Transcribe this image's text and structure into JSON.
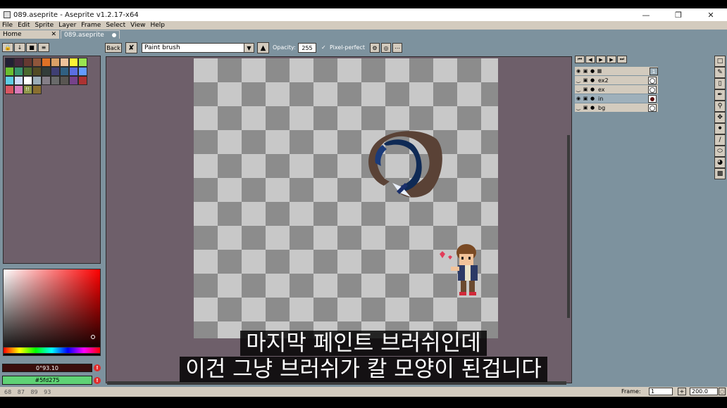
{
  "window": {
    "title": "089.aseprite - Aseprite v1.2.17-x64"
  },
  "menu": [
    "File",
    "Edit",
    "Sprite",
    "Layer",
    "Frame",
    "Select",
    "View",
    "Help"
  ],
  "tabs": [
    {
      "label": "Home"
    },
    {
      "label": "089.aseprite"
    }
  ],
  "context_bar": {
    "back_label": "Back",
    "brush": "Paint brush",
    "opacity_label": "Opacity:",
    "opacity_value": "255",
    "pixel_perfect_label": "Pixel-perfect"
  },
  "palette": {
    "colors": [
      "#222034",
      "#45283c",
      "#663931",
      "#8f563b",
      "#df7126",
      "#d9a066",
      "#eec39a",
      "#fbf236",
      "#99e550",
      "#6abe30",
      "#37946e",
      "#4b692f",
      "#524b24",
      "#323c39",
      "#3f3f74",
      "#306082",
      "#5b6ee1",
      "#639bff",
      "#5fcde4",
      "#cbdbfc",
      "#ffffff",
      "#9badb7",
      "#847e87",
      "#696a6a",
      "#595652",
      "#76428a",
      "#ac3232",
      "#d95763",
      "#d77bba",
      "#8f974a",
      "#8a6f30"
    ],
    "extra_label": "!!"
  },
  "colors": {
    "foreground_label": "0°93.10",
    "background_label": "#5fd275",
    "foreground_hex": "#3a0e0d",
    "background_hex": "#5fd275"
  },
  "layers": [
    {
      "name": "",
      "frame": "1"
    },
    {
      "name": "ex2"
    },
    {
      "name": "ex"
    },
    {
      "name": "in",
      "selected": true
    },
    {
      "name": "bg"
    }
  ],
  "status": {
    "coords": "68 87 89 93",
    "frame_label": "Frame:",
    "frame_value": "1",
    "zoom_value": "200.0"
  },
  "subtitles": {
    "line1": "마지막 페인트 브러쉬인데",
    "line2": "이건 그냥 브러쉬가 칼 모양이 된겁니다"
  }
}
